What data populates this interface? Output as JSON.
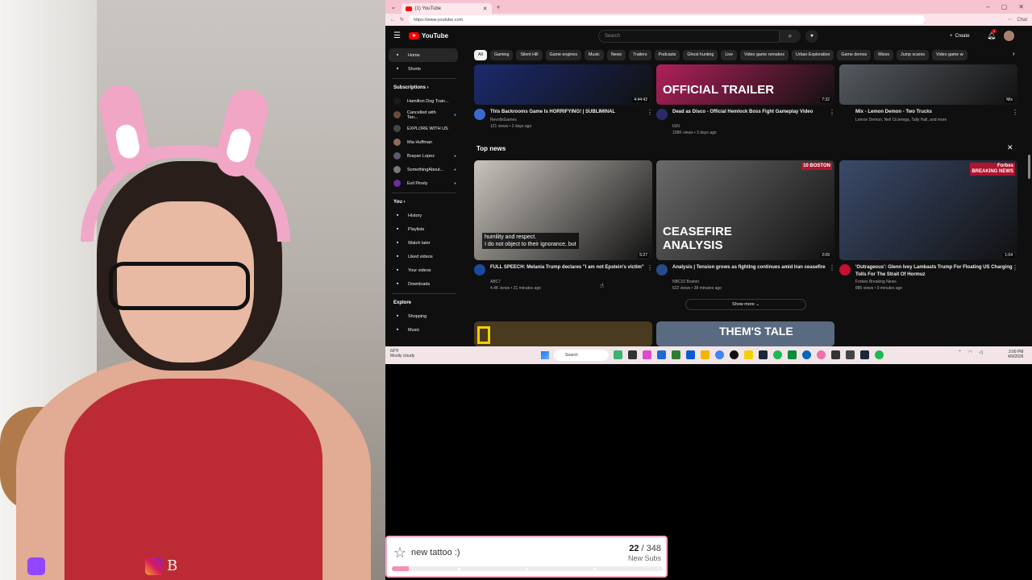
{
  "browser": {
    "tab_title": "(1) YouTube",
    "url": "https://www.youtube.com",
    "profile_label": "Chat"
  },
  "youtube": {
    "logo_text": "YouTube",
    "search_placeholder": "Search",
    "create_label": "Create",
    "notification_count": "1",
    "sidebar": {
      "primary": [
        {
          "label": "Home",
          "icon": "home-icon"
        },
        {
          "label": "Shorts",
          "icon": "shorts-icon"
        }
      ],
      "subscriptions_header": "Subscriptions",
      "subscriptions": [
        {
          "label": "Hamilton Dog Train...",
          "color": "#1a1a1a",
          "dot": false
        },
        {
          "label": "Cancelled with Tan...",
          "color": "#6b4a3a",
          "dot": true
        },
        {
          "label": "EXPLORE WITH US",
          "color": "#444444",
          "dot": false
        },
        {
          "label": "Mia Huffman",
          "color": "#8a6b5a",
          "dot": false
        },
        {
          "label": "Brayan Lopez",
          "color": "#5a5a6a",
          "dot": true
        },
        {
          "label": "SomethingAbout...",
          "color": "#777777",
          "dot": true
        },
        {
          "label": "Evil Pinely",
          "color": "#6a2da0",
          "dot": true
        }
      ],
      "you_header": "You",
      "you_items": [
        {
          "label": "History",
          "icon": "history-icon"
        },
        {
          "label": "Playlists",
          "icon": "playlists-icon"
        },
        {
          "label": "Watch later",
          "icon": "watch-later-icon"
        },
        {
          "label": "Liked videos",
          "icon": "liked-videos-icon"
        },
        {
          "label": "Your videos",
          "icon": "your-videos-icon"
        },
        {
          "label": "Downloads",
          "icon": "downloads-icon"
        }
      ],
      "explore_header": "Explore",
      "explore_items": [
        {
          "label": "Shopping",
          "icon": "shopping-icon"
        },
        {
          "label": "Music",
          "icon": "music-icon"
        }
      ]
    },
    "chips": [
      "All",
      "Gaming",
      "Silent Hill",
      "Game engines",
      "Music",
      "News",
      "Trailers",
      "Podcasts",
      "Ghost hunting",
      "Live",
      "Video game remakes",
      "Urban Exploration",
      "Game demos",
      "Mixes",
      "Jump scares",
      "Video game w"
    ],
    "top_row": [
      {
        "title": "This Backrooms Game Is HORRIFYING! | SUBLIMINAL",
        "channel": "RevoltsGames",
        "meta": "121 views • 2 days ago",
        "duration": "4:44:42",
        "thumb_color": "#1b2a6e",
        "avatar_color": "#3a6ad0"
      },
      {
        "title": "Dead as Disco - Official Hemlock Boss Fight Gameplay Video",
        "channel": "IGN",
        "meta": "158K views • 3 days ago",
        "duration": "7:32",
        "thumb_color": "#b0205a",
        "avatar_color": "#2a2a6a",
        "overlay": "OFFICIAL TRAILER"
      },
      {
        "title": "Mix - Lemon Demon - Two Trucks",
        "channel": "Lemon Demon, Neil Cicierega, Tally Hall, and more",
        "meta": "",
        "duration": "Mix",
        "thumb_color": "#555a60",
        "avatar_color": ""
      }
    ],
    "top_news_heading": "Top news",
    "news": [
      {
        "title": "FULL SPEECH: Melania Trump declares \"I am not Epstein's victim\"",
        "channel": "ABC7",
        "meta": "4.4K views • 21 minutes ago",
        "duration": "5:27",
        "caption": "humility and respect.\nI do not object to their ignorance, but",
        "thumb_color": "#c9c4bd",
        "avatar_color": "#1a4aa0"
      },
      {
        "title": "Analysis | Tension grows as fighting continues amid Iran ceasefire",
        "channel": "NBC10 Boston",
        "meta": "622 views • 38 minutes ago",
        "duration": "2:09",
        "overlay": "CEASEFIRE\nANALYSIS",
        "badge": "10 BOSTON",
        "thumb_color": "#6a6a6a",
        "avatar_color": "#2a4a8a"
      },
      {
        "title": "'Outrageous': Glenn Ivey Lambasts Trump For Floating US Charging Tolls For The Strait Of Hormuz",
        "channel": "Forbes Breaking News",
        "meta": "885 views • 9 minutes ago",
        "duration": "1:04",
        "badge": "Forbes\nBREAKING NEWS",
        "thumb_color": "#3a4a6a",
        "avatar_color": "#c8102e"
      }
    ],
    "show_more_label": "Show more",
    "bottom_overlay": "THEM'S TALE"
  },
  "taskbar": {
    "weather_temp": "60°F",
    "weather_desc": "Mostly cloudy",
    "search_label": "Search",
    "time": "3:00 PM",
    "date": "4/9/2026"
  },
  "subgoal": {
    "label": "new tattoo :)",
    "current": "22",
    "target": "/ 348",
    "unit": "New Subs",
    "progress": 0.063
  },
  "colors": {
    "youtube_red": "#ff0000",
    "subgoal_pink": "#f490b4",
    "browser_pink": "#f6c4d0"
  }
}
